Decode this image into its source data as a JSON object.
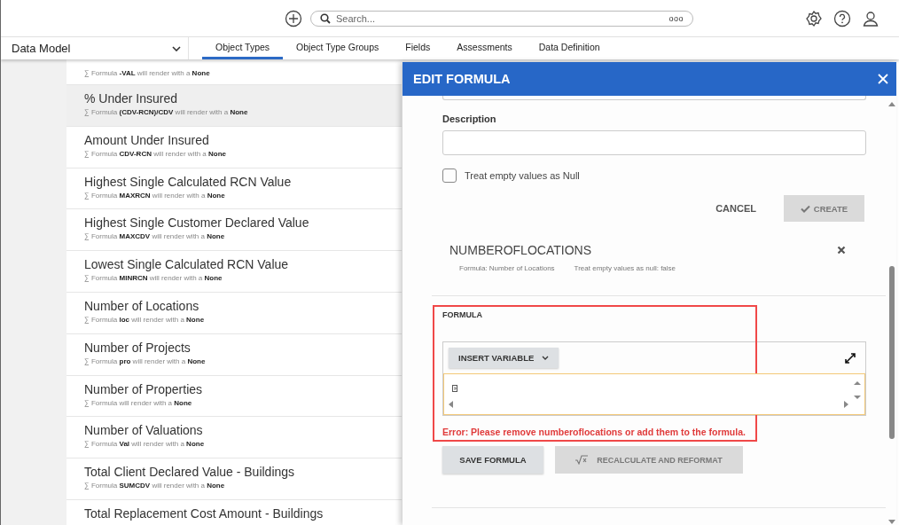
{
  "topbar": {
    "search": {
      "placeholder": "Search...",
      "hint": "ooo"
    }
  },
  "nav": {
    "title": "Data Model",
    "tabs": [
      {
        "label": "Object Types",
        "selected": true
      },
      {
        "label": "Object Type Groups",
        "selected": false
      },
      {
        "label": "Fields",
        "selected": false
      },
      {
        "label": "Assessments",
        "selected": false
      },
      {
        "label": "Data Definition",
        "selected": false
      }
    ]
  },
  "items": [
    {
      "formula": "∑ Formula **-VAL** will render with a **None**",
      "selected": false
    },
    {
      "title": "% Under Insured",
      "formula": "∑ Formula **(CDV-RCN)/CDV** will render with a **None**",
      "selected": true
    },
    {
      "title": "Amount Under Insured",
      "formula": "∑ Formula **CDV-RCN** will render with a **None**",
      "selected": false
    },
    {
      "title": "Highest Single Calculated RCN Value",
      "formula": "∑ Formula **MAXRCN** will render with a **None**",
      "selected": false
    },
    {
      "title": "Highest Single Customer Declared Value",
      "formula": "∑ Formula **MAXCDV** will render with a **None**",
      "selected": false
    },
    {
      "title": "Lowest Single Calculated RCN Value",
      "formula": "∑ Formula **MINRCN** will render with a **None**",
      "selected": false
    },
    {
      "title": "Number of Locations",
      "formula": "∑ Formula **loc** will render with a **None**",
      "selected": false
    },
    {
      "title": "Number of Projects",
      "formula": "∑ Formula **pro** will render with a **None**",
      "selected": false
    },
    {
      "title": "Number of Properties",
      "formula": "∑ Formula will render with a **None**",
      "selected": false
    },
    {
      "title": "Number of Valuations",
      "formula": "∑ Formula **Val** will render with a **None**",
      "selected": false
    },
    {
      "title": "Total Client Declared Value - Buildings",
      "formula": "∑ Formula **SUMCDV** will render with a **None**",
      "selected": false
    },
    {
      "title": "Total Replacement Cost Amount - Buildings",
      "selected": false
    }
  ],
  "panel": {
    "title": "EDIT FORMULA",
    "description_label": "Description",
    "null_checkbox": {
      "label": "Treat empty values as Null",
      "checked": false
    },
    "cancel": "CANCEL",
    "create": {
      "label": "CREATE",
      "disabled": true
    },
    "variable": {
      "name": "NUMBEROFLOCATIONS",
      "formula": "Formula: Number of Locations",
      "null_setting": "Treat empty values as null: false"
    },
    "formula": {
      "label": "FORMULA",
      "insert_variable": "INSERT VARIABLE",
      "error": "Error: Please remove numberoflocations or add them to the formula."
    },
    "save_formula": "SAVE FORMULA",
    "recalculate": {
      "label": "RECALCULATE AND REFORMAT",
      "disabled": true
    }
  }
}
